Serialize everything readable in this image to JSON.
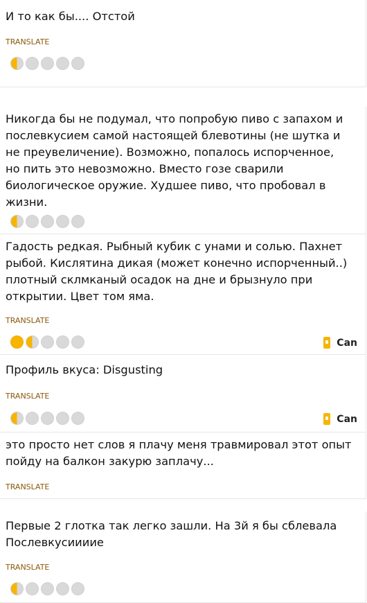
{
  "reviews": [
    {
      "text": "И то как бы.... Отстой",
      "translate_label": "TRANSLATE",
      "rating": 0.5
    },
    {
      "text": "Никогда бы не подумал, что попробую пиво с запахом и\nпослевкусием самой настоящей блевотины (не шутка и\nне преувеличение). Возможно, попалось испорченное,\nно пить это невозможно. Вместо гозе сварили\nбиологическое оружие. Худшее пиво, что пробовал в\nжизни.",
      "rating": 0.5
    },
    {
      "text": "Гадость редкая. Рыбный кубик с унами и солью. Пахнет\nрыбой. Кислятина дикая (может конечно испорченный..)\nплотный склмканый осадок на дне и брызнуло при\nоткрытии. Цвет том яма.",
      "translate_label": "TRANSLATE",
      "rating": 1.5,
      "serving": {
        "label": "Can",
        "icon": "can-icon"
      }
    },
    {
      "text": "Профиль вкуса: Disgusting",
      "translate_label": "TRANSLATE",
      "rating": 0.5,
      "serving": {
        "label": "Can",
        "icon": "can-icon"
      }
    },
    {
      "text": "это просто нет слов я плачу меня травмировал этот опыт\nпойду на балкон закурю заплачу...",
      "translate_label": "TRANSLATE"
    },
    {
      "text": "Первые 2 глотка так легко зашли. На 3й я бы сблевала\nПослевкусииииe",
      "translate_label": "TRANSLATE",
      "rating": 0.5
    }
  ],
  "rating_max": 5,
  "colors": {
    "cap_full": "#f7b500",
    "cap_empty": "#d9d9d9",
    "translate": "#8a5a0b"
  }
}
